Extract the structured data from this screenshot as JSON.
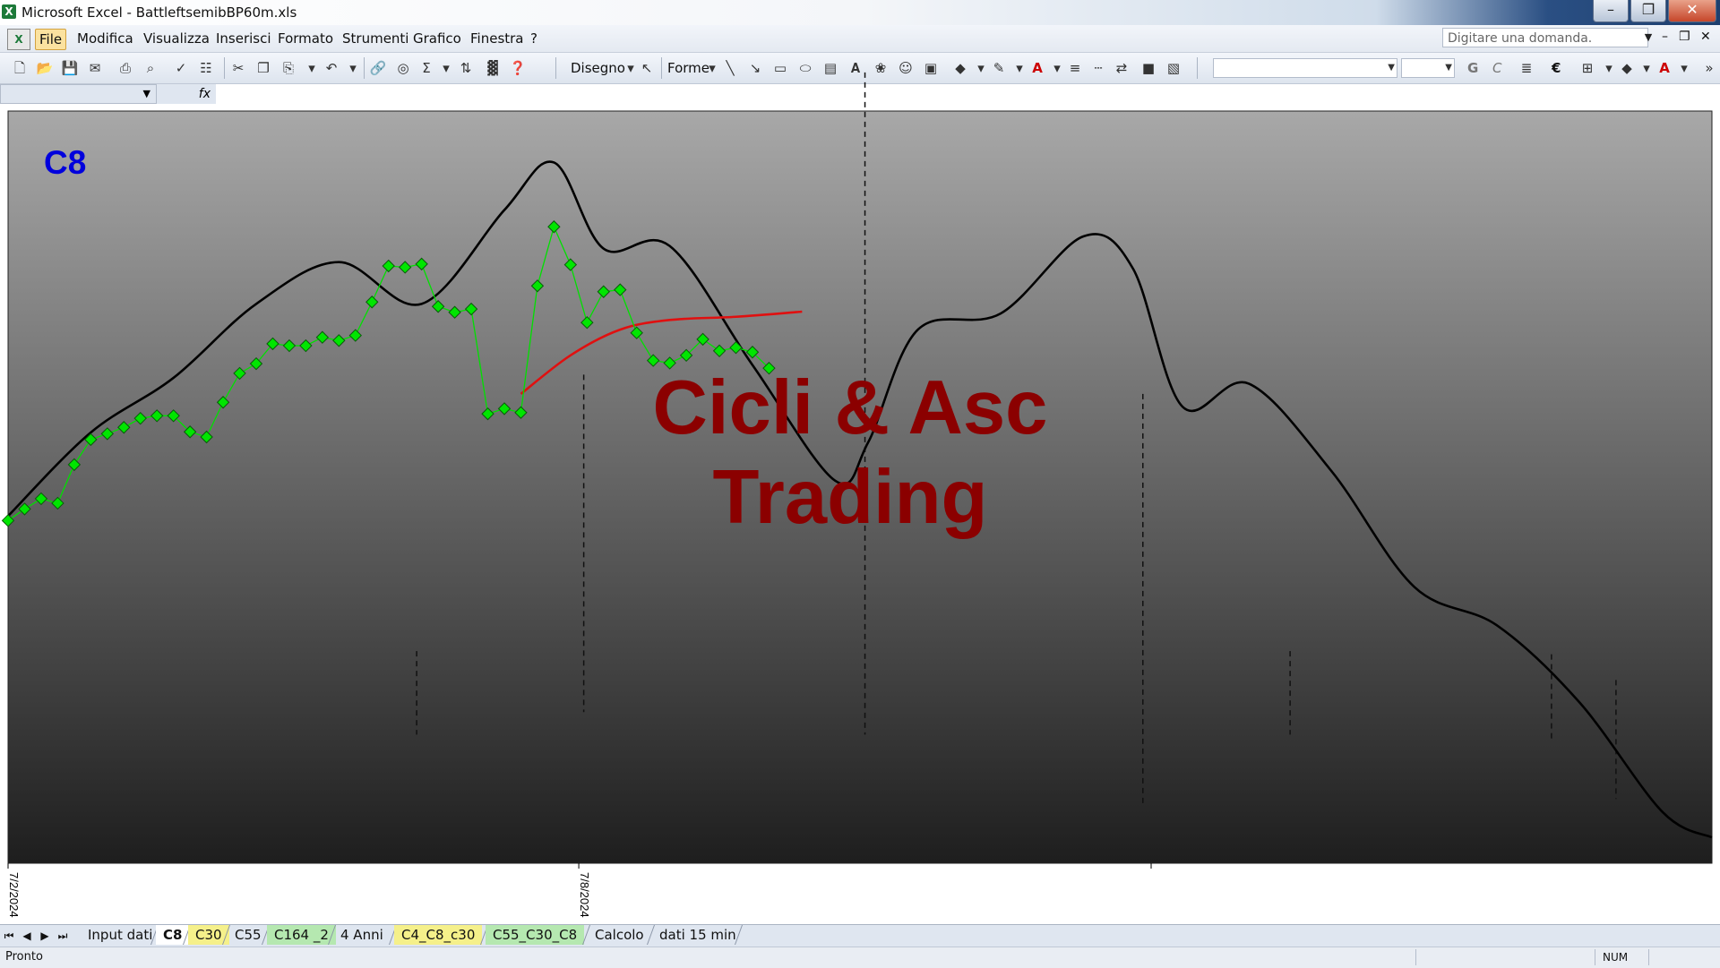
{
  "window": {
    "title": "Microsoft Excel - BattleftsemibBP60m.xls"
  },
  "menu": {
    "items": [
      {
        "label": "File",
        "active": true
      },
      {
        "label": "Modifica"
      },
      {
        "label": "Visualizza"
      },
      {
        "label": "Inserisci"
      },
      {
        "label": "Formato"
      },
      {
        "label": "Strumenti"
      },
      {
        "label": "Grafico"
      },
      {
        "label": "Finestra"
      },
      {
        "label": "?"
      }
    ],
    "ask_placeholder": "Digitare una domanda."
  },
  "toolbar": {
    "draw_label": "Disegno",
    "shapes_label": "Forme",
    "bold_label": "G",
    "italic_label": "C",
    "euro_label": "€"
  },
  "formula": {
    "fx_label": "fx"
  },
  "chart": {
    "label": "C8",
    "watermark_line1": "Cicli & Asc",
    "watermark_line2": "Trading",
    "x_tick_labels": [
      "7/2/2024",
      "7/8/2024"
    ]
  },
  "chart_data": {
    "type": "line",
    "title": "C8",
    "x": [
      0,
      1,
      2,
      3,
      4,
      5,
      6,
      7,
      8,
      9,
      10,
      11,
      12,
      13,
      14,
      15,
      16,
      17,
      18,
      19,
      20,
      21,
      22,
      23,
      24,
      25,
      26,
      27,
      28,
      29,
      30,
      31,
      32,
      33,
      34,
      35,
      36,
      37,
      38,
      39,
      40,
      41,
      42,
      43,
      44,
      45,
      46
    ],
    "series": [
      {
        "role": "price",
        "color": "#00e000",
        "marker": "diamond",
        "x": [
          0,
          1,
          2,
          3,
          4,
          5,
          6,
          7,
          8,
          9,
          10,
          11,
          12,
          13,
          14,
          15,
          16,
          17,
          18,
          19,
          20,
          21,
          22,
          23,
          24,
          25,
          26,
          27,
          28,
          29,
          30,
          31,
          32,
          33,
          34,
          35,
          36,
          37,
          38,
          39,
          40,
          41,
          42,
          43,
          44,
          45,
          46
        ],
        "y": [
          0.3,
          2.1,
          3.7,
          3.0,
          9.0,
          12.9,
          13.8,
          14.8,
          16.2,
          16.6,
          16.6,
          14.1,
          13.3,
          18.7,
          23.2,
          24.7,
          27.8,
          27.5,
          27.5,
          28.8,
          28.3,
          29.1,
          34.3,
          39.9,
          39.7,
          40.2,
          33.6,
          32.7,
          33.2,
          16.9,
          17.7,
          17.1,
          36.8,
          46.0,
          40.1,
          31.1,
          35.9,
          36.2,
          29.5,
          25.2,
          24.8,
          26.0,
          28.5,
          26.7,
          27.2,
          26.5,
          24.0
        ],
        "note_y_scale": "y in arbitrary vertical units (no numeric value axis shown)"
      },
      {
        "role": "cycle",
        "color": "#000000",
        "smooth": true,
        "x": [
          0,
          5,
          10,
          15,
          20,
          25,
          30,
          33,
          36,
          40,
          45,
          50,
          52,
          55,
          60,
          65,
          68,
          71,
          75,
          80,
          85,
          90,
          95,
          100,
          103
        ],
        "y": [
          1.0,
          14.0,
          22.5,
          34.0,
          40.5,
          34.0,
          48.6,
          56.0,
          42.6,
          43.0,
          24.5,
          6.5,
          12.5,
          30.0,
          32.5,
          44.5,
          39.5,
          18.0,
          21.6,
          8.0,
          -10.0,
          -16.0,
          -28.0,
          -45.0,
          -49.0
        ]
      },
      {
        "role": "average",
        "color": "#e01010",
        "x": [
          31,
          34,
          37,
          40,
          44,
          48
        ],
        "y": [
          20.0,
          26.0,
          30.0,
          31.5,
          32.0,
          32.8
        ]
      }
    ],
    "vertical_lines": [
      {
        "x": 24.7,
        "y_top": -20.0,
        "y_bottom": -33.0,
        "style": "dashed"
      },
      {
        "x": 34.8,
        "y_top": 23.0,
        "y_bottom": -29.5,
        "style": "dashed"
      },
      {
        "x": 51.8,
        "y_top": 70.0,
        "y_bottom": -33.0,
        "style": "dashed"
      },
      {
        "x": 68.6,
        "y_top": 20.0,
        "y_bottom": -44.0,
        "style": "dashed"
      },
      {
        "x": 77.5,
        "y_top": -20.0,
        "y_bottom": -33.0,
        "style": "dashed"
      },
      {
        "x": 93.3,
        "y_top": -20.5,
        "y_bottom": -34.0,
        "style": "dashed"
      },
      {
        "x": 97.2,
        "y_top": -24.5,
        "y_bottom": -43.0,
        "style": "dashed"
      }
    ],
    "xlim": [
      0,
      103
    ],
    "ylim": [
      -53,
      64
    ],
    "x_ticks": [
      {
        "x": 0,
        "label": "7/2/2024"
      },
      {
        "x": 34.5,
        "label": "7/8/2024"
      },
      {
        "x": 69.1,
        "label": ""
      }
    ],
    "grid": false,
    "background": "vertical gradient gray #a8a8a8 to #202020",
    "legend": "none"
  },
  "sheets": {
    "tabs": [
      {
        "label": "Input dati",
        "color": "none"
      },
      {
        "label": "C8",
        "color": "none",
        "active": true
      },
      {
        "label": "C30",
        "color": "yellow"
      },
      {
        "label": "C55",
        "color": "none"
      },
      {
        "label": "C164 _2",
        "color": "green"
      },
      {
        "label": "4 Anni",
        "color": "none"
      },
      {
        "label": "C4_C8_c30",
        "color": "yellow"
      },
      {
        "label": "C55_C30_C8",
        "color": "green"
      },
      {
        "label": "Calcolo",
        "color": "none"
      },
      {
        "label": "dati 15 min",
        "color": "none"
      }
    ]
  },
  "status": {
    "text": "Pronto",
    "num_indicator": "NUM"
  }
}
